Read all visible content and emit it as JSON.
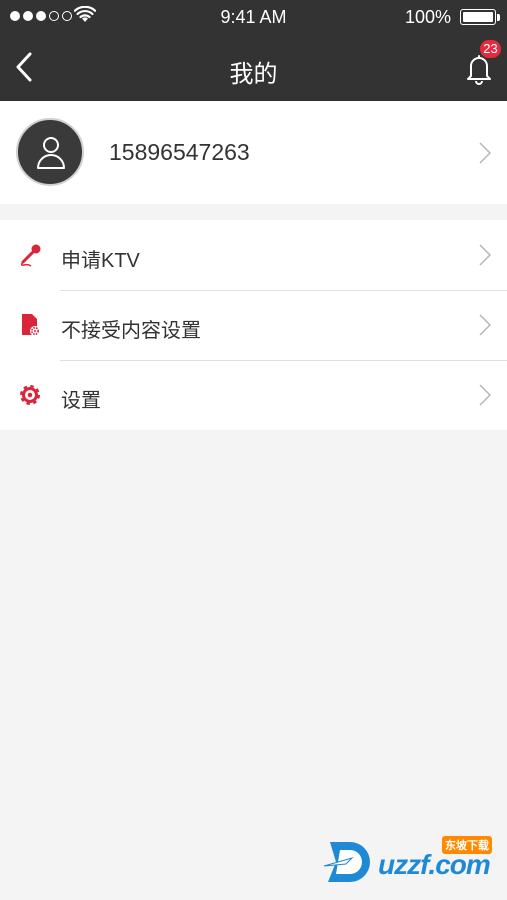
{
  "status": {
    "time": "9:41 AM",
    "battery": "100%",
    "signal_bars_filled": 3,
    "signal_bars_total": 5
  },
  "nav": {
    "title": "我的",
    "back_icon": "chevron-left-icon",
    "bell_icon": "bell-icon",
    "badge_count": "23"
  },
  "profile": {
    "phone": "15896547263",
    "avatar_icon": "user-icon"
  },
  "menu": {
    "items": [
      {
        "label": "申请KTV",
        "icon": "microphone-icon"
      },
      {
        "label": "不接受内容设置",
        "icon": "document-settings-icon"
      },
      {
        "label": "设置",
        "icon": "gear-icon"
      }
    ]
  },
  "watermark": {
    "text": "uzzf.com",
    "sub": "东坡下载"
  },
  "colors": {
    "header_bg": "#333333",
    "accent_red": "#d9263a",
    "badge_red": "#e8283c",
    "page_bg": "#f4f4f4"
  }
}
